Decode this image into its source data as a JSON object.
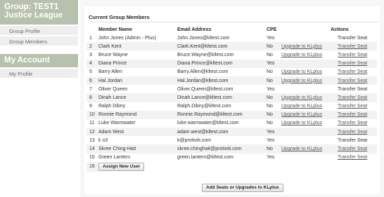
{
  "sidebar": {
    "group_title": "Group: TEST1 Justice League",
    "group_items": [
      {
        "label": "Group Profile"
      },
      {
        "label": "Group Members"
      }
    ],
    "account_title": "My Account",
    "account_items": [
      {
        "label": "My Profile"
      }
    ]
  },
  "main": {
    "title": "Current Group Members",
    "columns": {
      "name": "Member Name",
      "email": "Email Address",
      "cpe": "CPE",
      "actions": "Actions"
    },
    "rows": [
      {
        "num": "1",
        "name": "John Jones (Admin - Plus)",
        "email": "John.Jones@kltest.com",
        "cpe": "Yes",
        "upgrade": "",
        "transfer": "Transfer Seat",
        "transfer_link": false
      },
      {
        "num": "2",
        "name": "Clark Kent",
        "email": "Clark.Kent@kltest.com",
        "cpe": "No",
        "upgrade": "Upgrade to KLplus",
        "transfer": "Transfer Seat",
        "transfer_link": true
      },
      {
        "num": "3",
        "name": "Bruce Wayne",
        "email": "Bruce.Wayne@kltest.com",
        "cpe": "No",
        "upgrade": "Upgrade to KLplus",
        "transfer": "Transfer Seat",
        "transfer_link": true
      },
      {
        "num": "4",
        "name": "Diana Prince",
        "email": "Diana.Prince@kltest.com",
        "cpe": "Yes",
        "upgrade": "",
        "transfer": "Transfer Seat",
        "transfer_link": true
      },
      {
        "num": "5",
        "name": "Barry Allen",
        "email": "Barry.Allen@kltest.com",
        "cpe": "No",
        "upgrade": "Upgrade to KLplus",
        "transfer": "Transfer Seat",
        "transfer_link": true
      },
      {
        "num": "6",
        "name": "Hal Jordan",
        "email": "Hal.Jordan@kltest.com",
        "cpe": "No",
        "upgrade": "Upgrade to KLplus",
        "transfer": "Transfer Seat",
        "transfer_link": true
      },
      {
        "num": "7",
        "name": "Oliver Queen",
        "email": "Oliver.Queen@kltest.com",
        "cpe": "Yes",
        "upgrade": "",
        "transfer": "Transfer Seat",
        "transfer_link": false
      },
      {
        "num": "8",
        "name": "Dinah Lance",
        "email": "Dinah.Lance@kltest.com",
        "cpe": "No",
        "upgrade": "Upgrade to KLplus",
        "transfer": "Transfer Seat",
        "transfer_link": true
      },
      {
        "num": "9",
        "name": "Ralph Dibny",
        "email": "Ralph.Dibny@kltest.com",
        "cpe": "No",
        "upgrade": "Upgrade to KLplus",
        "transfer": "Transfer Seat",
        "transfer_link": true
      },
      {
        "num": "10",
        "name": "Ronnie Raymond",
        "email": "Ronnie.Raymond@kltest.com",
        "cpe": "No",
        "upgrade": "Upgrade to KLplus",
        "transfer": "Transfer Seat",
        "transfer_link": true
      },
      {
        "num": "11",
        "name": "Luke Warmwater",
        "email": "luke.warmwater@kltest.com",
        "cpe": "No",
        "upgrade": "Upgrade to KLplus",
        "transfer": "Transfer Seat",
        "transfer_link": true
      },
      {
        "num": "12",
        "name": "Adam West",
        "email": "adam.west@kltest.com",
        "cpe": "Yes",
        "upgrade": "",
        "transfer": "Transfer Seat",
        "transfer_link": true
      },
      {
        "num": "13",
        "name": "k o3",
        "email": "k@protiviti.com",
        "cpe": "Yes",
        "upgrade": "",
        "transfer": "Transfer Seat",
        "transfer_link": false
      },
      {
        "num": "14",
        "name": "Skree Ching-Hait",
        "email": "skree.chinghait@protiviti.com",
        "cpe": "No",
        "upgrade": "Upgrade to KLplus",
        "transfer": "Transfer Seat",
        "transfer_link": true
      },
      {
        "num": "15",
        "name": "Green Lantern",
        "email": "green.lantern@kltest.com",
        "cpe": "Yes",
        "upgrade": "",
        "transfer": "Transfer Seat",
        "transfer_link": true
      }
    ],
    "assign_row_num": "16",
    "assign_button": "Assign New User",
    "add_seats_button": "Add Seats or Upgrades to KLplus"
  }
}
